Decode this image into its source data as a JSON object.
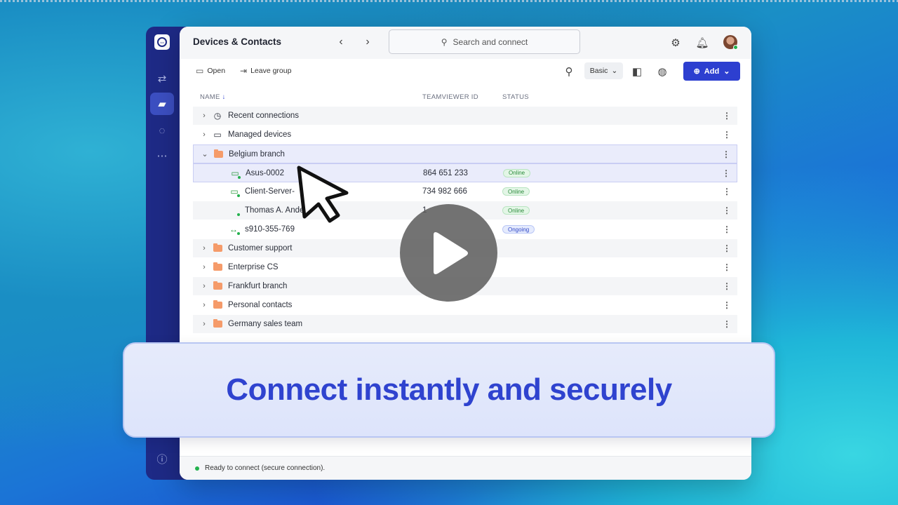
{
  "app": {
    "title": "Devices & Contacts",
    "search_placeholder": "Search and connect"
  },
  "toolbar": {
    "open_label": "Open",
    "leave_group_label": "Leave group",
    "view_mode": "Basic",
    "add_label": "Add"
  },
  "columns": {
    "name": "NAME",
    "teamviewer_id": "TEAMVIEWER ID",
    "status": "STATUS"
  },
  "rows": [
    {
      "name": "Recent connections",
      "icon": "clock-icon",
      "level": 0,
      "expanded": false
    },
    {
      "name": "Managed devices",
      "icon": "monitor-icon",
      "level": 0,
      "expanded": false
    },
    {
      "name": "Belgium branch",
      "icon": "folder-icon",
      "level": 0,
      "expanded": true
    },
    {
      "name": "Asus-0002",
      "icon": "computer-icon",
      "level": 1,
      "id": "864 651 233",
      "status": "Online"
    },
    {
      "name": "Client-Server-",
      "icon": "computer-icon",
      "level": 1,
      "id": "734 982 666",
      "status": "Online"
    },
    {
      "name": "Thomas A. Ande",
      "icon": "contact-icon",
      "level": 1,
      "id": "1",
      "status": "Online"
    },
    {
      "name": "s910-355-769",
      "icon": "remote-session-icon",
      "level": 1,
      "id": "",
      "status": "Ongoing"
    },
    {
      "name": "Customer support",
      "icon": "folder-icon",
      "level": 0,
      "expanded": false
    },
    {
      "name": "Enterprise CS",
      "icon": "folder-icon",
      "level": 0,
      "expanded": false
    },
    {
      "name": "Frankfurt branch",
      "icon": "folder-icon",
      "level": 0,
      "expanded": false
    },
    {
      "name": "Personal contacts",
      "icon": "folder-icon",
      "level": 0,
      "expanded": false
    },
    {
      "name": "Germany sales team",
      "icon": "folder-icon",
      "level": 0,
      "expanded": false
    }
  ],
  "statusbar": {
    "text": "Ready to connect (secure connection)."
  },
  "caption": {
    "text": "Connect instantly and securely"
  },
  "colors": {
    "accent": "#2d3fd0",
    "rail": "#1e2a86",
    "caption_text": "#2f43cf",
    "online": "#23b14d"
  }
}
